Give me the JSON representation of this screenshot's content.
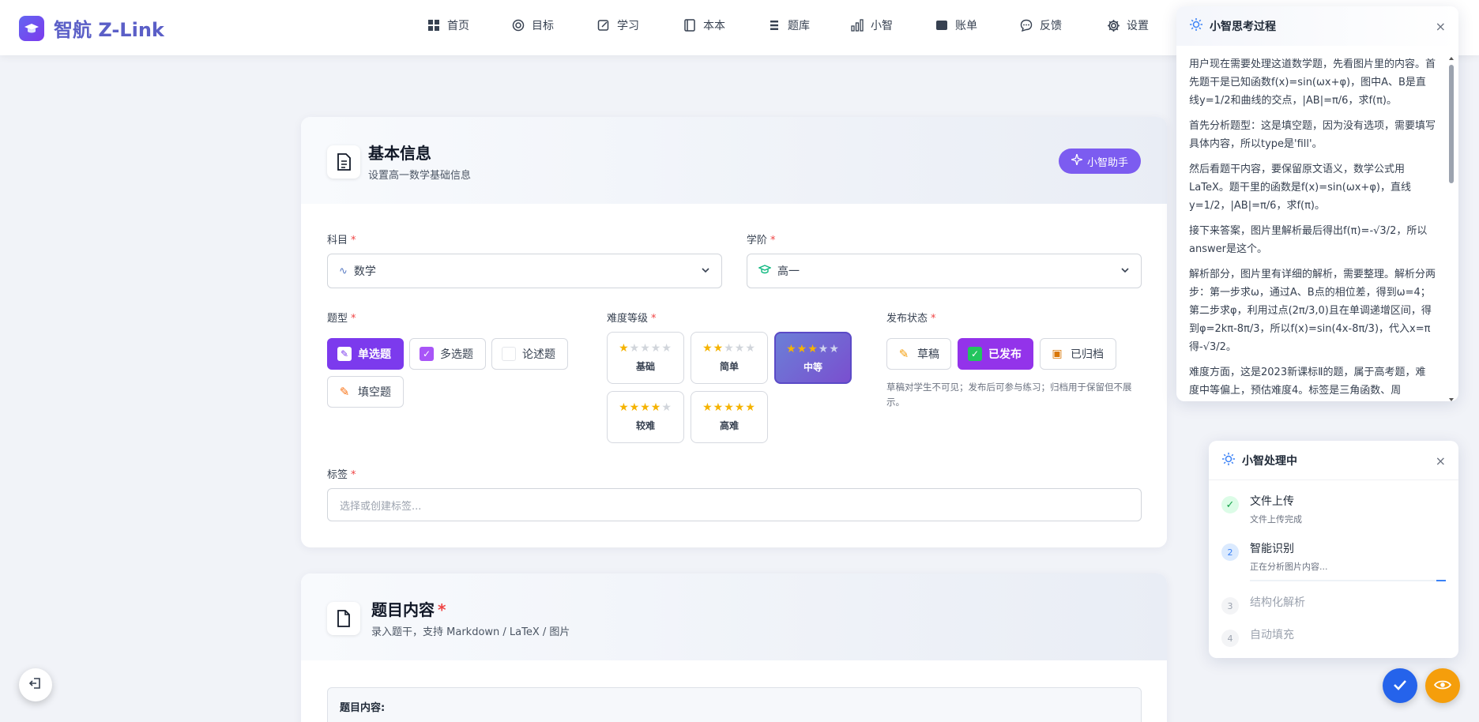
{
  "brand": {
    "name": "智航 Z-Link"
  },
  "nav": {
    "items": [
      {
        "label": "首页",
        "icon": "grid-icon"
      },
      {
        "label": "目标",
        "icon": "target-icon"
      },
      {
        "label": "学习",
        "icon": "edit-icon"
      },
      {
        "label": "本本",
        "icon": "notebook-icon"
      },
      {
        "label": "题库",
        "icon": "list-icon"
      },
      {
        "label": "小智",
        "icon": "bar-chart-icon"
      },
      {
        "label": "账单",
        "icon": "wallet-icon"
      },
      {
        "label": "反馈",
        "icon": "message-icon"
      },
      {
        "label": "设置",
        "icon": "gear-icon"
      }
    ]
  },
  "basic_card": {
    "title": "基本信息",
    "subtitle": "设置高一数学基础信息",
    "assistant_button": "小智助手",
    "subject": {
      "label": "科目",
      "required": "*",
      "value": "数学"
    },
    "grade": {
      "label": "学阶",
      "required": "*",
      "value": "高一"
    },
    "question_type": {
      "label": "题型",
      "required": "*",
      "options": [
        "单选题",
        "多选题",
        "论述题",
        "填空题"
      ],
      "selected": "单选题"
    },
    "difficulty": {
      "label": "难度等级",
      "required": "*",
      "levels": [
        {
          "label": "基础",
          "stars": 1
        },
        {
          "label": "简单",
          "stars": 2
        },
        {
          "label": "中等",
          "stars": 3
        },
        {
          "label": "较难",
          "stars": 4
        },
        {
          "label": "高难",
          "stars": 5
        }
      ],
      "selected": "中等",
      "max_stars": 5
    },
    "publish": {
      "label": "发布状态",
      "required": "*",
      "options": [
        "草稿",
        "已发布",
        "已归档"
      ],
      "selected": "已发布",
      "hint": "草稿对学生不可见；发布后可参与练习；归档用于保留但不展示。"
    },
    "tags": {
      "label": "标签",
      "required": "*",
      "placeholder": "选择或创建标签..."
    }
  },
  "content_card": {
    "title": "题目内容",
    "required": "*",
    "subtitle": "录入题干，支持 Markdown / LaTeX / 图片",
    "field_label": "题目内容:"
  },
  "think_panel": {
    "title": "小智思考过程",
    "close": "×",
    "paragraphs": [
      "用户现在需要处理这道数学题，先看图片里的内容。首先题干是已知函数f(x)=sin(ωx+φ)，图中A、B是直线y=1/2和曲线的交点，|AB|=π/6，求f(π)。",
      "首先分析题型：这是填空题，因为没有选项，需要填写具体内容，所以type是'fill'。",
      "然后看题干内容，要保留原文语义，数学公式用LaTeX。题干里的函数是f(x)=sin(ωx+φ)，直线y=1/2，|AB|=π/6，求f(π)。",
      "接下来答案，图片里解析最后得出f(π)=-√3/2，所以answer是这个。",
      "解析部分，图片里有详细的解析，需要整理。解析分两步：第一步求ω，通过A、B点的相位差，得到ω=4；第二步求φ，利用过点(2π/3,0)且在单调递增区间，得到φ=2kπ-8π/3，所以f(x)=sin(4x-8π/3)，代入x=π得-√3/2。",
      "难度方面，这是2023新课标Ⅱ的题，属于高考题，难度中等偏上，预估难度4。标签是三角函数、周"
    ]
  },
  "process_panel": {
    "title": "小智处理中",
    "close": "×",
    "steps": [
      {
        "num": "✓",
        "title": "文件上传",
        "desc": "文件上传完成",
        "state": "done"
      },
      {
        "num": "2",
        "title": "智能识别",
        "desc": "正在分析图片内容...",
        "state": "active"
      },
      {
        "num": "3",
        "title": "结构化解析",
        "desc": "",
        "state": "pending"
      },
      {
        "num": "4",
        "title": "自动填充",
        "desc": "",
        "state": "pending"
      }
    ]
  },
  "colors": {
    "accent": "#7c3aed",
    "brand": "#5b5fc7",
    "star": "#f5b301",
    "fab_blue": "#2563eb",
    "fab_amber": "#f59e0b"
  }
}
